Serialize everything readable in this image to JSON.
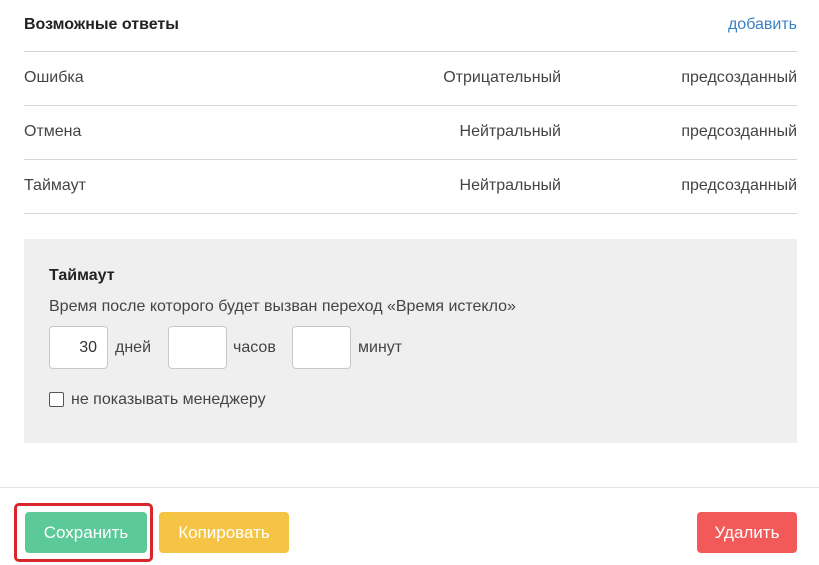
{
  "answers_section": {
    "title": "Возможные ответы",
    "add_link": "добавить"
  },
  "answers": [
    {
      "name": "Ошибка",
      "tone": "Отрицательный",
      "origin": "предсозданный"
    },
    {
      "name": "Отмена",
      "tone": "Нейтральный",
      "origin": "предсозданный"
    },
    {
      "name": "Таймаут",
      "tone": "Нейтральный",
      "origin": "предсозданный"
    }
  ],
  "timeout": {
    "title": "Таймаут",
    "description": "Время после которого будет вызван переход «Время истекло»",
    "days_value": "30",
    "days_label": "дней",
    "hours_value": "",
    "hours_label": "часов",
    "minutes_value": "",
    "minutes_label": "минут",
    "hide_checkbox_checked": false,
    "hide_checkbox_label": "не показывать менеджеру"
  },
  "buttons": {
    "save": "Сохранить",
    "copy": "Копировать",
    "delete": "Удалить"
  },
  "colors": {
    "link": "#3b82c4",
    "save": "#5cc998",
    "copy": "#f5c445",
    "delete": "#f25a5a",
    "panel_bg": "#efefef",
    "highlight": "#d9262b"
  }
}
